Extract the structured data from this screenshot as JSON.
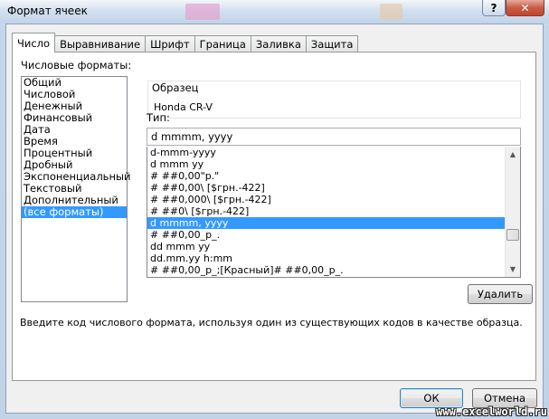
{
  "window": {
    "title": "Формат ячеек",
    "help_label": "?",
    "close_label": "✕"
  },
  "tabs": [
    {
      "label": "Число",
      "active": true
    },
    {
      "label": "Выравнивание",
      "active": false
    },
    {
      "label": "Шрифт",
      "active": false
    },
    {
      "label": "Граница",
      "active": false
    },
    {
      "label": "Заливка",
      "active": false
    },
    {
      "label": "Защита",
      "active": false
    }
  ],
  "categories": {
    "label": "Числовые форматы:",
    "items": [
      "Общий",
      "Числовой",
      "Денежный",
      "Финансовый",
      "Дата",
      "Время",
      "Процентный",
      "Дробный",
      "Экспоненциальный",
      "Текстовый",
      "Дополнительный",
      "(все форматы)"
    ],
    "selected_index": 11
  },
  "sample": {
    "label": "Образец",
    "value": "Honda CR-V"
  },
  "type": {
    "label": "Тип:",
    "value": "d mmmm, yyyy"
  },
  "formats": {
    "items": [
      "d-mmm-yyyy",
      "d mmm yy",
      "# ##0,00\"р.\"",
      "# ##0,00\\ [$грн.-422]",
      "# ##0,000\\ [$грн.-422]",
      "# ##0\\ [$грн.-422]",
      "d mmmm, yyyy",
      "# ##0,00_р_.",
      "dd mmm yy",
      "dd.mm.yy h:mm",
      "# ##0,00_р_;[Красный]# ##0,00_р_."
    ],
    "selected_index": 6
  },
  "buttons": {
    "delete": "Удалить",
    "ok": "ОК",
    "cancel": "Отмена"
  },
  "hint": "Введите код числового формата, используя один из существующих кодов в качестве образца.",
  "watermark": "www.excelworld.ru",
  "colors": {
    "selection": "#3399ff",
    "title_gradient_top": "#f3f6fa",
    "close_button": "#c75b46"
  }
}
